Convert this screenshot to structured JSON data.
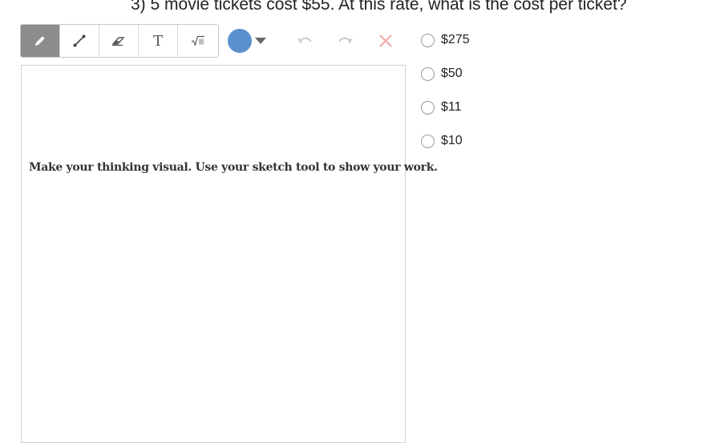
{
  "question": {
    "text": "3) 5 movie tickets cost $55. At this rate, what is the cost per ticket?"
  },
  "toolbar": {
    "tools": [
      {
        "icon": "pencil-icon",
        "active": true
      },
      {
        "icon": "line-icon",
        "active": false
      },
      {
        "icon": "eraser-icon",
        "active": false
      },
      {
        "icon": "text-icon",
        "label": "T",
        "active": false
      },
      {
        "icon": "math-icon",
        "active": false
      }
    ],
    "color": "#5b90cf",
    "actions": [
      "undo-icon",
      "redo-icon",
      "clear-icon"
    ]
  },
  "canvas": {
    "prompt": "Make your thinking visual. Use your sketch tool to show your work."
  },
  "choices": [
    {
      "label": "$275"
    },
    {
      "label": "$50"
    },
    {
      "label": "$11"
    },
    {
      "label": "$10"
    }
  ]
}
